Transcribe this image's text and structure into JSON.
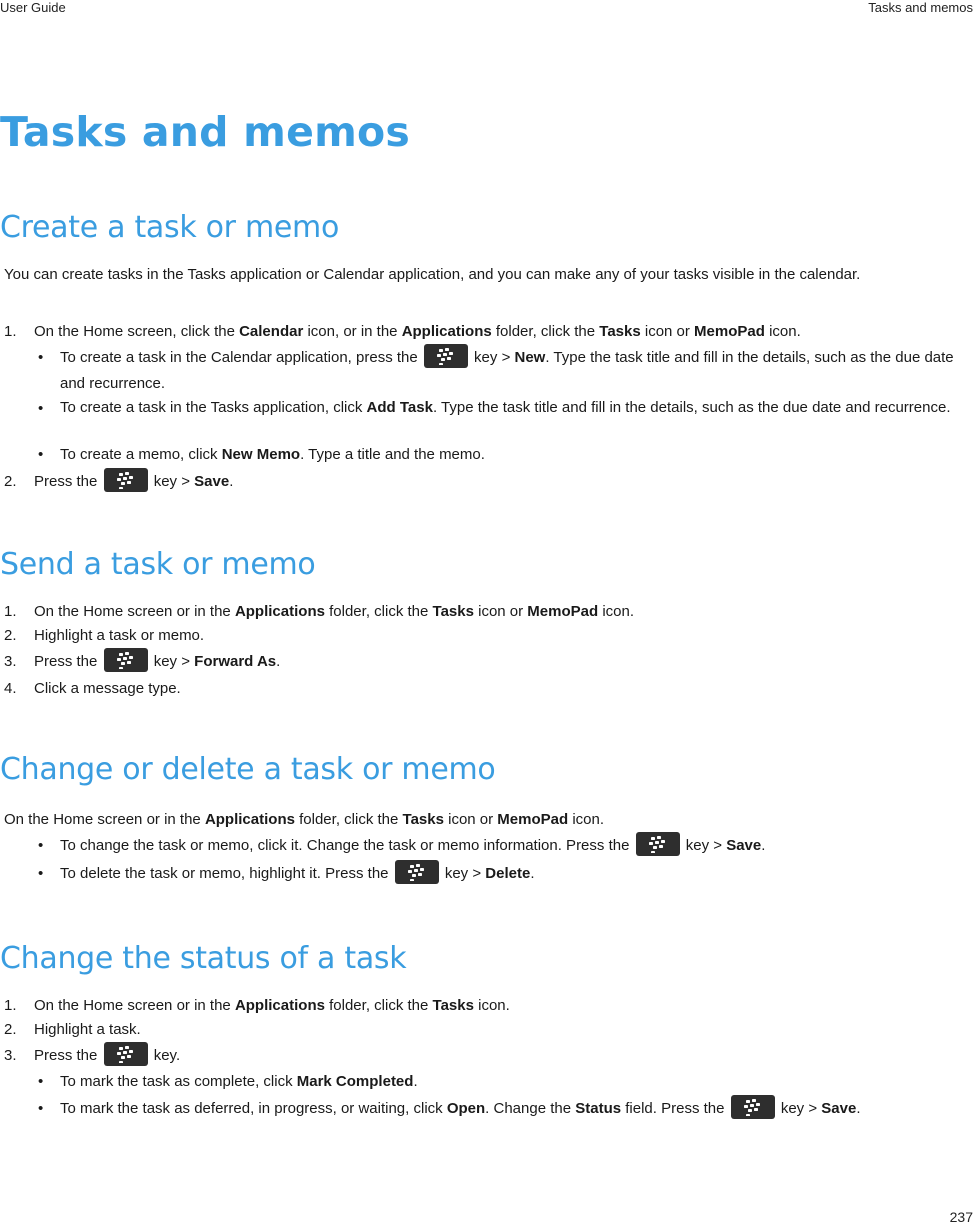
{
  "header": {
    "left": "User Guide",
    "right": "Tasks and memos"
  },
  "page_number": "237",
  "title": "Tasks and memos",
  "icons": {
    "menu_key": "blackberry-menu-key-icon"
  },
  "sections": [
    {
      "heading": "Create a task or memo",
      "intro": "You can create tasks in the Tasks application or Calendar application, and you can make any of your tasks visible in the calendar.",
      "steps": [
        {
          "num": "1.",
          "parts": [
            "On the Home screen, click the ",
            "Calendar",
            " icon, or in the ",
            "Applications",
            " folder, click the ",
            "Tasks",
            " icon or ",
            "MemoPad",
            " icon."
          ],
          "bullets": [
            {
              "pre": "To create a task in the Calendar application, press the",
              "post": " key > ",
              "bold": "New",
              "tail": ". Type the task title and fill in the details, such as the due date and recurrence."
            },
            {
              "pre": "To create a task in the Tasks application, click ",
              "bold": "Add Task",
              "tail": ". Type the task title and fill in the details, such as the due date and recurrence."
            },
            {
              "pre": "To create a memo, click ",
              "bold": "New Memo",
              "tail": ". Type a title and the memo."
            }
          ]
        },
        {
          "num": "2.",
          "pre": "Press the",
          "post": " key > ",
          "bold": "Save",
          "tail": "."
        }
      ]
    },
    {
      "heading": "Send a task or memo",
      "steps": [
        {
          "num": "1.",
          "parts": [
            "On the Home screen or in the ",
            "Applications",
            " folder, click the ",
            "Tasks",
            " icon or ",
            "MemoPad",
            " icon."
          ]
        },
        {
          "num": "2.",
          "text": "Highlight a task or memo."
        },
        {
          "num": "3.",
          "pre": "Press the",
          "post": " key > ",
          "bold": "Forward As",
          "tail": "."
        },
        {
          "num": "4.",
          "text": "Click a message type."
        }
      ]
    },
    {
      "heading": "Change or delete a task or memo",
      "intro_parts": [
        "On the Home screen or in the ",
        "Applications",
        " folder, click the ",
        "Tasks",
        " icon or ",
        "MemoPad",
        " icon."
      ],
      "bullets": [
        {
          "pre": "To change the task or memo, click it. Change the task or memo information. Press the",
          "post": " key > ",
          "bold": "Save",
          "tail": "."
        },
        {
          "pre": "To delete the task or memo, highlight it. Press the",
          "post": " key > ",
          "bold": "Delete",
          "tail": "."
        }
      ]
    },
    {
      "heading": "Change the status of a task",
      "steps": [
        {
          "num": "1.",
          "parts": [
            "On the Home screen or in the ",
            "Applications",
            " folder, click the ",
            "Tasks",
            " icon."
          ]
        },
        {
          "num": "2.",
          "text": "Highlight a task."
        },
        {
          "num": "3.",
          "pre": "Press the",
          "post": " key."
        }
      ],
      "bullets": [
        {
          "pre": "To mark the task as complete, click ",
          "bold": "Mark Completed",
          "tail": "."
        },
        {
          "pre": "To mark the task as deferred, in progress, or waiting, click ",
          "bold": "Open",
          "mid": ". Change the ",
          "bold2": "Status",
          "mid2": " field. Press the",
          "post": " key > ",
          "bold3": "Save",
          "tail": "."
        }
      ]
    }
  ]
}
